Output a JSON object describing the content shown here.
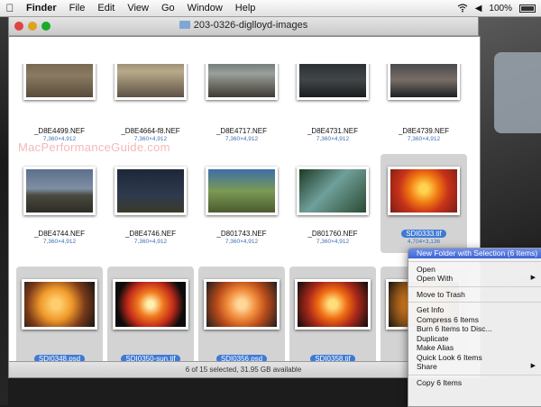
{
  "menubar": {
    "apple": "",
    "items": [
      "Finder",
      "File",
      "Edit",
      "View",
      "Go",
      "Window",
      "Help"
    ],
    "battery": "100%"
  },
  "window": {
    "title": "203-0326-diglloyd-images",
    "status": "6 of 15 selected, 31.95 GB available"
  },
  "toolbar": {
    "back_icon": "back-arrow-icon",
    "forward_icon": "forward-arrow-icon",
    "views": [
      "icon-view",
      "list-view",
      "column-view",
      "coverflow-view"
    ],
    "action_icon": "gear-icon",
    "arrange_icon": "arrange-icon",
    "share_icon": "share-icon",
    "search_icon": "search-icon",
    "search_placeholder": ""
  },
  "watermark": "MacPerformanceGuide.com",
  "files": [
    {
      "name": "_D8E4499.NEF",
      "dims": "7,360×4,912",
      "selected": false
    },
    {
      "name": "_D8E4664-f8.NEF",
      "dims": "7,360×4,912",
      "selected": false
    },
    {
      "name": "_D8E4717.NEF",
      "dims": "7,360×4,912",
      "selected": false
    },
    {
      "name": "_D8E4731.NEF",
      "dims": "7,360×4,912",
      "selected": false
    },
    {
      "name": "_D8E4739.NEF",
      "dims": "7,360×4,912",
      "selected": false
    },
    {
      "name": "_D8E4744.NEF",
      "dims": "7,360×4,912",
      "selected": false
    },
    {
      "name": "_D8E4746.NEF",
      "dims": "7,360×4,912",
      "selected": false
    },
    {
      "name": "_D801743.NEF",
      "dims": "7,360×4,912",
      "selected": false
    },
    {
      "name": "_D801760.NEF",
      "dims": "7,360×4,912",
      "selected": false
    },
    {
      "name": "SDI0333.tif",
      "dims": "4,704×3,136",
      "selected": true
    },
    {
      "name": "SDI0348.psd",
      "dims": "4,704×3,136",
      "selected": true
    },
    {
      "name": "SDI0350-sun.tif",
      "dims": "4,704×3,136",
      "selected": true
    },
    {
      "name": "SDI0356.psd",
      "dims": "4,704×3,136",
      "selected": true
    },
    {
      "name": "SDI0358.tif",
      "dims": "4,704×3,136",
      "selected": true
    },
    {
      "name": "",
      "dims": "",
      "selected": true
    }
  ],
  "context_menu": {
    "items": [
      {
        "label": "New Folder with Selection (6 Items)",
        "highlight": true
      },
      {
        "sep": true
      },
      {
        "label": "Open"
      },
      {
        "label": "Open With",
        "submenu": "▶"
      },
      {
        "sep": true
      },
      {
        "label": "Move to Trash"
      },
      {
        "sep": true
      },
      {
        "label": "Get Info"
      },
      {
        "label": "Compress 6 Items"
      },
      {
        "label": "Burn 6 Items to Disc..."
      },
      {
        "label": "Duplicate"
      },
      {
        "label": "Make Alias"
      },
      {
        "label": "Quick Look 6 Items"
      },
      {
        "label": "Share",
        "submenu": "▶"
      },
      {
        "sep": true
      },
      {
        "label": "Copy 6 Items"
      }
    ]
  }
}
